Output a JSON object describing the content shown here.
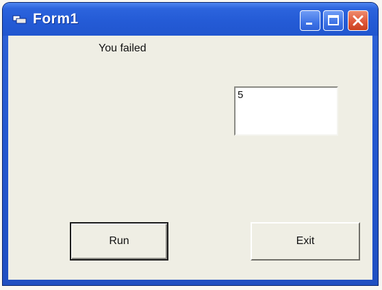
{
  "window": {
    "title": "Form1",
    "icon": "form-app-icon",
    "controls": {
      "minimize_icon": "minimize-icon",
      "maximize_icon": "maximize-icon",
      "close_icon": "close-icon"
    }
  },
  "form": {
    "status_label": "You failed",
    "textbox_value": "5",
    "run_button": "Run",
    "exit_button": "Exit"
  },
  "colors": {
    "titlebar": "#245bd6",
    "client_background": "#efeee4",
    "close_button": "#e0593a"
  }
}
